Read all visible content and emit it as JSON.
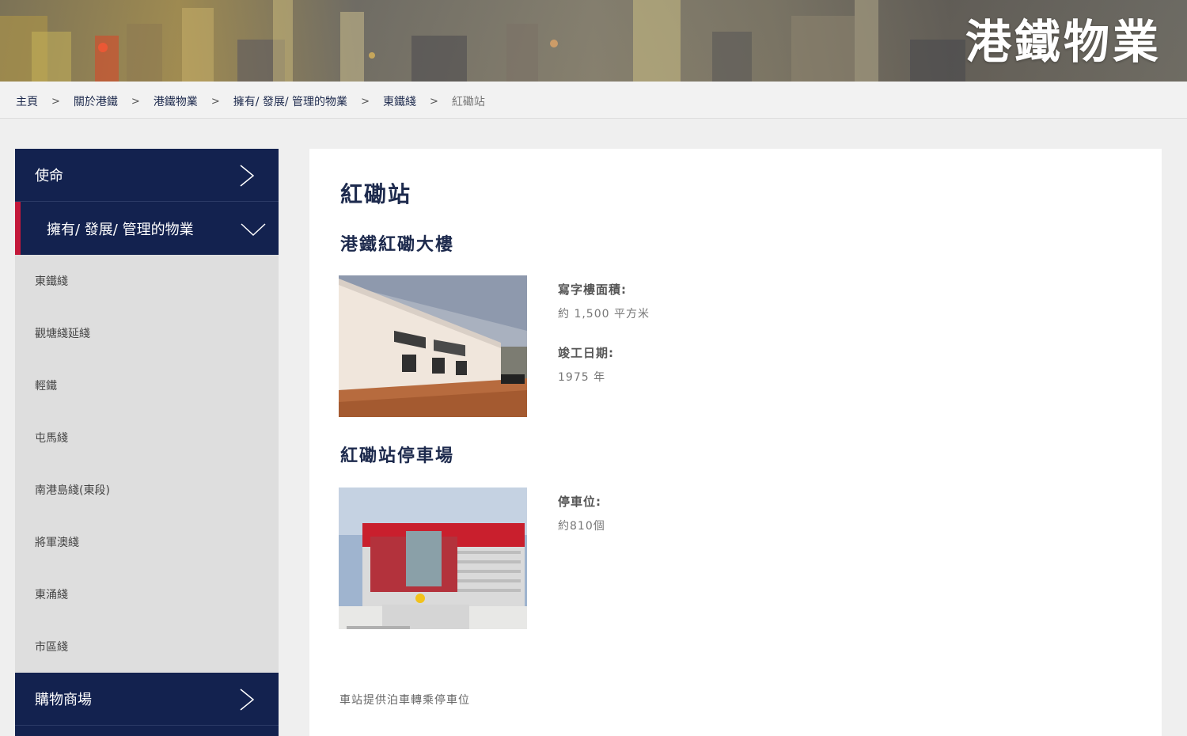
{
  "banner": {
    "title": "港鐵物業"
  },
  "breadcrumb": [
    {
      "label": "主頁"
    },
    {
      "label": "關於港鐵"
    },
    {
      "label": "港鐵物業"
    },
    {
      "label": "擁有/ 發展/ 管理的物業"
    },
    {
      "label": "東鐵綫"
    },
    {
      "label": "紅磡站"
    }
  ],
  "breadcrumb_separator": ">",
  "sidebar": {
    "mission": "使命",
    "properties": "擁有/ 發展/ 管理的物業",
    "sub_items": [
      "東鐵綫",
      "觀塘綫延綫",
      "輕鐵",
      "屯馬綫",
      "南港島綫(東段)",
      "將軍澳綫",
      "東涌綫",
      "市區綫"
    ],
    "shopping": "購物商場"
  },
  "main": {
    "title": "紅磡站",
    "section1": {
      "title": "港鐵紅磡大樓",
      "office_area_label": "寫字樓面積:",
      "office_area_value": "約 1,500 平方米",
      "completion_label": "竣工日期:",
      "completion_value": "1975 年"
    },
    "section2": {
      "title": "紅磡站停車場",
      "parking_label": "停車位:",
      "parking_value": "約810個",
      "caption": "車站提供泊車轉乘停車位"
    }
  },
  "colors": {
    "navy": "#13224f",
    "accent_red": "#c3183a",
    "sidebar_gray": "#dedede"
  }
}
